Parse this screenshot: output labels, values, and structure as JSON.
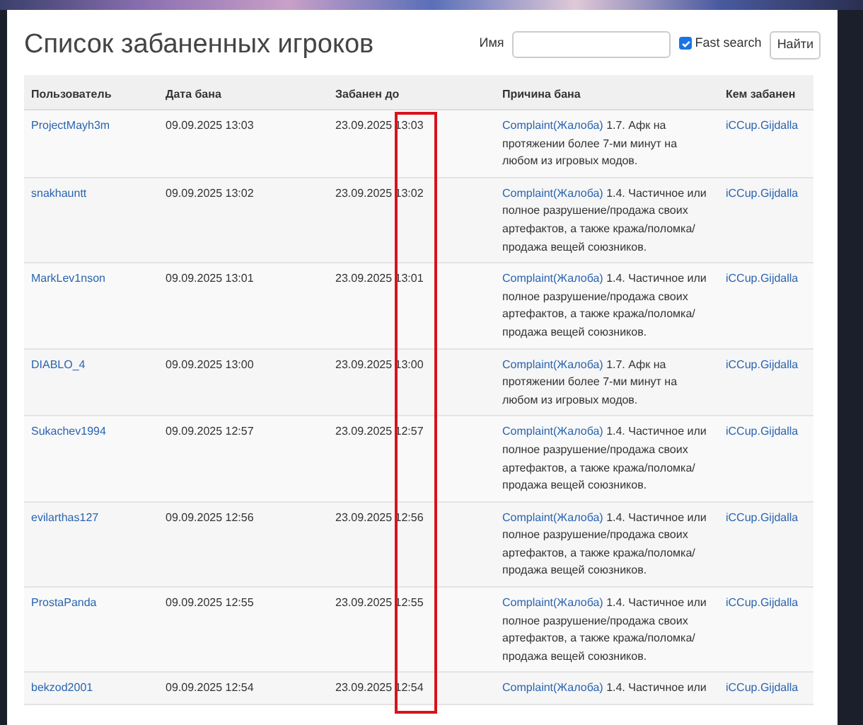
{
  "title": "Список забаненных игроков",
  "search": {
    "label": "Имя",
    "fast_search": {
      "label": "Fast search",
      "checked": true
    },
    "button": "Найти"
  },
  "table": {
    "columns": [
      "Пользователь",
      "Дата бана",
      "Забанен до",
      "Причина бана",
      "Кем забанен"
    ],
    "rows": [
      {
        "user": "ProjectMayh3m",
        "ban_date": "09.09.2025 13:03",
        "until": "23.09.2025 13:03",
        "reason_link": "Complaint(Жалоба)",
        "reason": "1.7. Афк на протяжении более 7-ми минут на любом из игровых модов.",
        "banned_by": "iCCup.Gijdalla"
      },
      {
        "user": "snakhauntt",
        "ban_date": "09.09.2025 13:02",
        "until": "23.09.2025 13:02",
        "reason_link": "Complaint(Жалоба)",
        "reason": "1.4. Частичное или полное разрушение/продажа своих артефактов, а также кража/поломка/ продажа вещей союзников.",
        "banned_by": "iCCup.Gijdalla"
      },
      {
        "user": "MarkLev1nson",
        "ban_date": "09.09.2025 13:01",
        "until": "23.09.2025 13:01",
        "reason_link": "Complaint(Жалоба)",
        "reason": "1.4. Частичное или полное разрушение/продажа своих артефактов, а также кража/поломка/ продажа вещей союзников.",
        "banned_by": "iCCup.Gijdalla"
      },
      {
        "user": "DIABLO_4",
        "ban_date": "09.09.2025 13:00",
        "until": "23.09.2025 13:00",
        "reason_link": "Complaint(Жалоба)",
        "reason": "1.7. Афк на протяжении более 7-ми минут на любом из игровых модов.",
        "banned_by": "iCCup.Gijdalla"
      },
      {
        "user": "Sukachev1994",
        "ban_date": "09.09.2025 12:57",
        "until": "23.09.2025 12:57",
        "reason_link": "Complaint(Жалоба)",
        "reason": "1.4. Частичное или полное разрушение/продажа своих артефактов, а также кража/поломка/ продажа вещей союзников.",
        "banned_by": "iCCup.Gijdalla"
      },
      {
        "user": "evilarthas127",
        "ban_date": "09.09.2025 12:56",
        "until": "23.09.2025 12:56",
        "reason_link": "Complaint(Жалоба)",
        "reason": "1.4. Частичное или полное разрушение/продажа своих артефактов, а также кража/поломка/ продажа вещей союзников.",
        "banned_by": "iCCup.Gijdalla"
      },
      {
        "user": "ProstaPanda",
        "ban_date": "09.09.2025 12:55",
        "until": "23.09.2025 12:55",
        "reason_link": "Complaint(Жалоба)",
        "reason": "1.4. Частичное или полное разрушение/продажа своих артефактов, а также кража/поломка/ продажа вещей союзников.",
        "banned_by": "iCCup.Gijdalla"
      },
      {
        "user": "bekzod2001",
        "ban_date": "09.09.2025 12:54",
        "until": "23.09.2025 12:54",
        "reason_link": "Complaint(Жалоба)",
        "reason": "1.4. Частичное или",
        "banned_by": "iCCup.Gijdalla"
      }
    ]
  }
}
